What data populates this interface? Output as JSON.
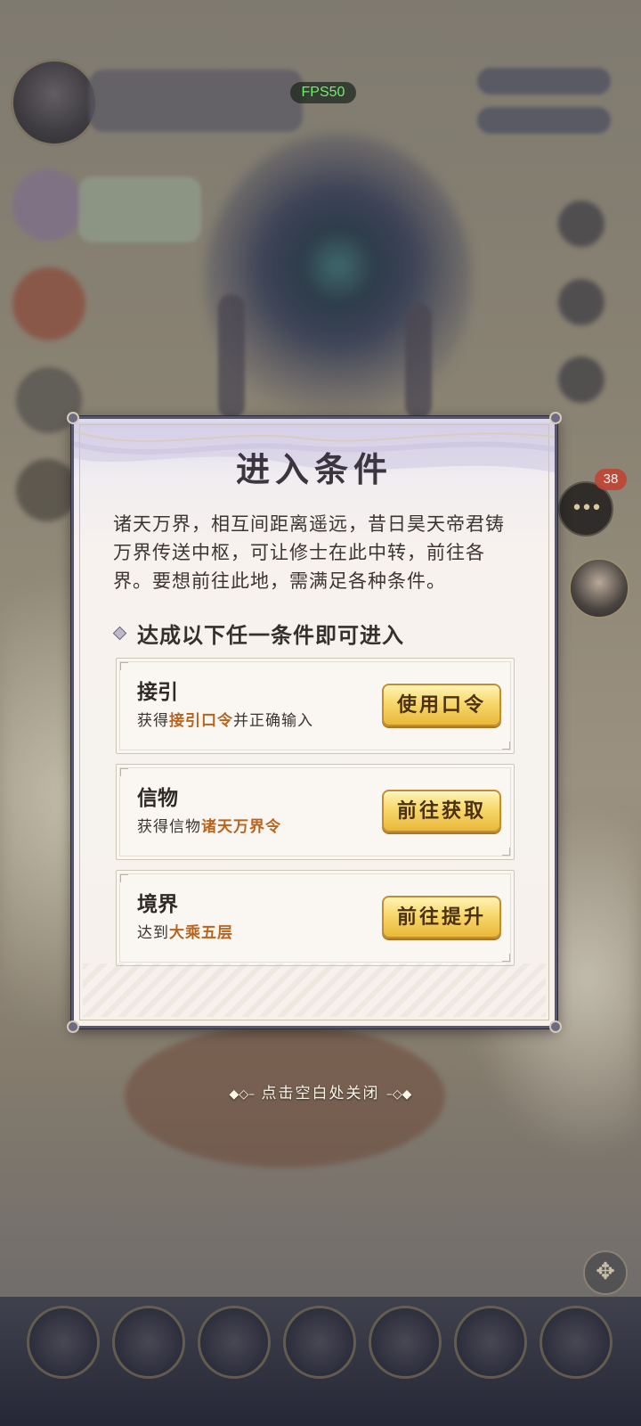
{
  "hud": {
    "fps": "FPS50",
    "chat_badge": "38",
    "chat_icon": "chat-ellipsis-icon"
  },
  "dialog": {
    "title": "进入条件",
    "description": "诸天万界，相互间距离遥远，昔日昊天帝君铸万界传送中枢，可让修士在此中转，前往各界。要想前往此地，需满足各种条件。",
    "subheading": "达成以下任一条件即可进入",
    "conditions": [
      {
        "title": "接引",
        "desc_prefix": "获得",
        "desc_highlight": "接引口令",
        "desc_suffix": "并正确输入",
        "button": "使用口令"
      },
      {
        "title": "信物",
        "desc_prefix": "获得信物",
        "desc_highlight": "诸天万界令",
        "desc_suffix": "",
        "button": "前往获取"
      },
      {
        "title": "境界",
        "desc_prefix": "达到",
        "desc_highlight": "大乘五层",
        "desc_suffix": "",
        "button": "前往提升"
      }
    ]
  },
  "close_hint": "点击空白处关闭",
  "colors": {
    "highlight": "#b8641f",
    "button_gold": "#f7d86c",
    "fps_green": "#6cf06c"
  }
}
